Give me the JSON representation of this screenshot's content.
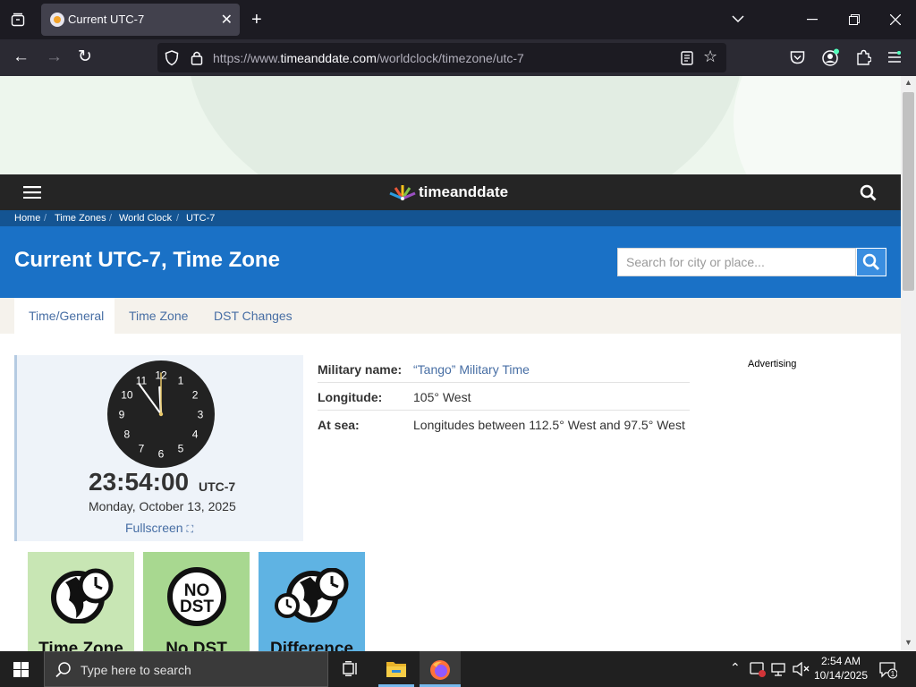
{
  "browser": {
    "tab_title": "Current UTC-7",
    "url_prefix": "https://www.",
    "url_domain": "timeanddate.com",
    "url_path": "/worldclock/timezone/utc-7"
  },
  "site": {
    "logo_text": "timeanddate",
    "breadcrumb": [
      "Home",
      "Time Zones",
      "World Clock",
      "UTC-7"
    ],
    "page_title": "Current UTC-7, Time Zone",
    "search_placeholder": "Search for city or place...",
    "tabs": [
      "Time/General",
      "Time Zone",
      "DST Changes"
    ]
  },
  "clock": {
    "time": "23:54:00",
    "tz": "UTC-7",
    "date": "Monday, October 13, 2025",
    "fullscreen_label": "Fullscreen",
    "numerals": [
      "12",
      "1",
      "2",
      "3",
      "4",
      "5",
      "6",
      "7",
      "8",
      "9",
      "10",
      "11"
    ]
  },
  "info": [
    {
      "label": "Military name:",
      "value": "“Tango” Military Time",
      "link": true
    },
    {
      "label": "Longitude:",
      "value": "105° West",
      "link": false
    },
    {
      "label": "At sea:",
      "value": "Longitudes between 112.5° West and 97.5° West",
      "link": false
    }
  ],
  "advertising_label": "Advertising",
  "tiles": [
    {
      "label": "Time Zone",
      "color": "#c8e6b4"
    },
    {
      "label": "No DST",
      "color": "#a8d890",
      "badge": "NO DST"
    },
    {
      "label": "Difference",
      "color": "#5fb3e3"
    }
  ],
  "taskbar": {
    "search_placeholder": "Type here to search",
    "time": "2:54 AM",
    "date": "10/14/2025",
    "notification_count": "1"
  },
  "colors": {
    "site_header": "#252525",
    "breadcrumb_bg": "#145492",
    "title_bg": "#1a71c6",
    "link": "#476ea4"
  }
}
